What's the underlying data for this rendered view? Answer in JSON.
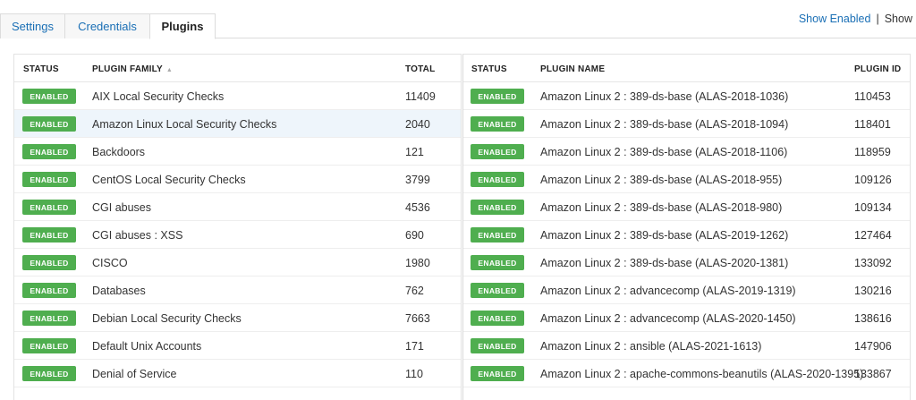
{
  "tabs": [
    {
      "label": "Settings"
    },
    {
      "label": "Credentials"
    },
    {
      "label": "Plugins"
    }
  ],
  "show_links": {
    "enabled": "Show Enabled",
    "separator": "|",
    "show": "Show"
  },
  "families_table": {
    "headers": {
      "status": "STATUS",
      "family": "PLUGIN FAMILY",
      "total": "TOTAL"
    },
    "rows": [
      {
        "status": "ENABLED",
        "family": "AIX Local Security Checks",
        "total": "11409"
      },
      {
        "status": "ENABLED",
        "family": "Amazon Linux Local Security Checks",
        "total": "2040"
      },
      {
        "status": "ENABLED",
        "family": "Backdoors",
        "total": "121"
      },
      {
        "status": "ENABLED",
        "family": "CentOS Local Security Checks",
        "total": "3799"
      },
      {
        "status": "ENABLED",
        "family": "CGI abuses",
        "total": "4536"
      },
      {
        "status": "ENABLED",
        "family": "CGI abuses : XSS",
        "total": "690"
      },
      {
        "status": "ENABLED",
        "family": "CISCO",
        "total": "1980"
      },
      {
        "status": "ENABLED",
        "family": "Databases",
        "total": "762"
      },
      {
        "status": "ENABLED",
        "family": "Debian Local Security Checks",
        "total": "7663"
      },
      {
        "status": "ENABLED",
        "family": "Default Unix Accounts",
        "total": "171"
      },
      {
        "status": "ENABLED",
        "family": "Denial of Service",
        "total": "110"
      }
    ]
  },
  "plugins_table": {
    "headers": {
      "status": "STATUS",
      "name": "PLUGIN NAME",
      "id": "PLUGIN ID"
    },
    "rows": [
      {
        "status": "ENABLED",
        "name": "Amazon Linux 2 : 389-ds-base (ALAS-2018-1036)",
        "id": "110453"
      },
      {
        "status": "ENABLED",
        "name": "Amazon Linux 2 : 389-ds-base (ALAS-2018-1094)",
        "id": "118401"
      },
      {
        "status": "ENABLED",
        "name": "Amazon Linux 2 : 389-ds-base (ALAS-2018-1106)",
        "id": "118959"
      },
      {
        "status": "ENABLED",
        "name": "Amazon Linux 2 : 389-ds-base (ALAS-2018-955)",
        "id": "109126"
      },
      {
        "status": "ENABLED",
        "name": "Amazon Linux 2 : 389-ds-base (ALAS-2018-980)",
        "id": "109134"
      },
      {
        "status": "ENABLED",
        "name": "Amazon Linux 2 : 389-ds-base (ALAS-2019-1262)",
        "id": "127464"
      },
      {
        "status": "ENABLED",
        "name": "Amazon Linux 2 : 389-ds-base (ALAS-2020-1381)",
        "id": "133092"
      },
      {
        "status": "ENABLED",
        "name": "Amazon Linux 2 : advancecomp (ALAS-2019-1319)",
        "id": "130216"
      },
      {
        "status": "ENABLED",
        "name": "Amazon Linux 2 : advancecomp (ALAS-2020-1450)",
        "id": "138616"
      },
      {
        "status": "ENABLED",
        "name": "Amazon Linux 2 : ansible (ALAS-2021-1613)",
        "id": "147906"
      },
      {
        "status": "ENABLED",
        "name": "Amazon Linux 2 : apache-commons-beanutils (ALAS-2020-1395)",
        "id": "133867"
      }
    ]
  },
  "colors": {
    "enabled_badge": "#4fae4f",
    "link": "#1a6fb5",
    "highlight_row": "#eef5fb"
  },
  "sort": {
    "column": "family",
    "direction": "ascending",
    "icon": "sort-asc-icon"
  }
}
